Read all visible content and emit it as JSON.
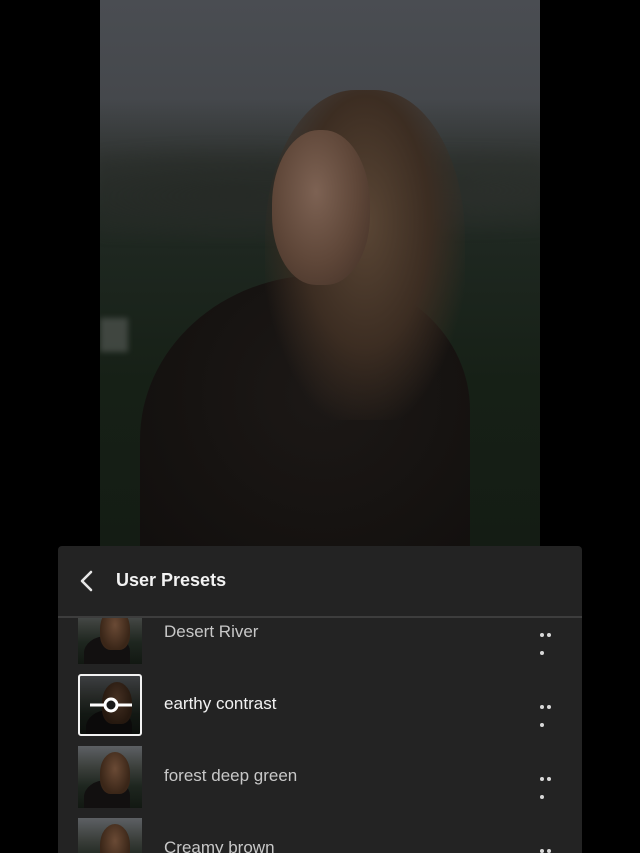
{
  "panel": {
    "title": "User Presets",
    "back_icon": "chevron-left-icon",
    "more_icon": "more-horizontal-icon",
    "preset_icon": "preset-slider-icon"
  },
  "presets": [
    {
      "label": "Desert River",
      "selected": false
    },
    {
      "label": "earthy contrast",
      "selected": true
    },
    {
      "label": "forest deep green",
      "selected": false
    },
    {
      "label": "Creamy brown",
      "selected": false
    }
  ],
  "colors": {
    "panel_bg": "#232323",
    "text_primary": "#f2f2f2",
    "text_secondary": "#c8c8c8"
  }
}
